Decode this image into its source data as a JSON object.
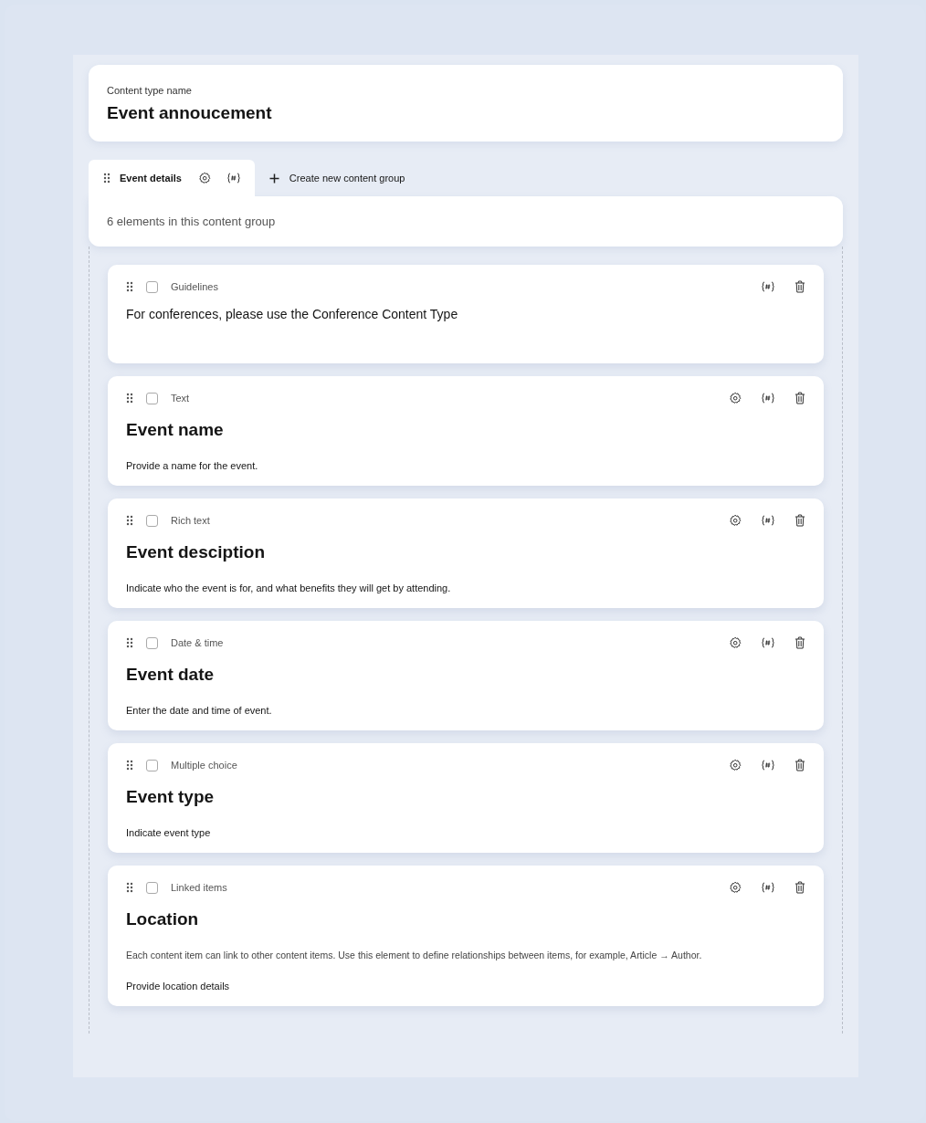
{
  "content_type": {
    "label": "Content type name",
    "name": "Event annoucement"
  },
  "tabs": [
    {
      "label": "Event details",
      "selected": true
    }
  ],
  "new_group": {
    "label": "Create new content group"
  },
  "group_summary": "6 elements in this content group",
  "elements": [
    {
      "kind": "guidelines",
      "type_label": "Guidelines",
      "checked": false,
      "text": "For conferences, please use the Conference Content Type"
    },
    {
      "kind": "field",
      "type_label": "Text",
      "checked": false,
      "title": "Event name",
      "guidance": "Provide a name for the event."
    },
    {
      "kind": "field",
      "type_label": "Rich text",
      "checked": false,
      "title": "Event desciption",
      "guidance": "Indicate who the event is for, and what benefits they will get by attending."
    },
    {
      "kind": "field",
      "type_label": "Date & time",
      "checked": false,
      "title": "Event date",
      "guidance": "Enter the date and time of event."
    },
    {
      "kind": "field",
      "type_label": "Multiple choice",
      "checked": false,
      "title": "Event type",
      "guidance": "Indicate event type"
    },
    {
      "kind": "field",
      "type_label": "Linked items",
      "checked": false,
      "title": "Location",
      "note": "Each content item can link to other content items. Use this element to define relationships between items, for example, Article → Author.",
      "guidance": "Provide location details"
    }
  ]
}
